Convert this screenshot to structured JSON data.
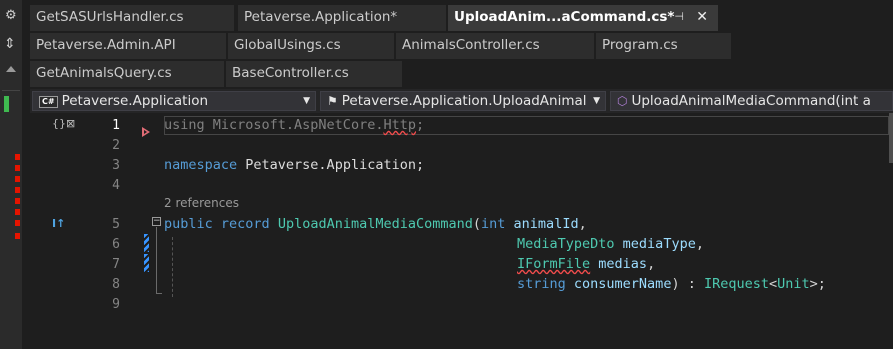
{
  "tabs": {
    "row1": [
      {
        "label": "GetSASUrlsHandler.cs",
        "active": false
      },
      {
        "label": "Petaverse.Application*",
        "active": false
      },
      {
        "label": "UploadAnim...aCommand.cs*",
        "active": true
      }
    ],
    "row2": [
      {
        "label": "Petaverse.Admin.API"
      },
      {
        "label": "GlobalUsings.cs"
      },
      {
        "label": "AnimalsController.cs"
      },
      {
        "label": "Program.cs"
      }
    ],
    "row3": [
      {
        "label": "GetAnimalsQuery.cs"
      },
      {
        "label": "BaseController.cs"
      }
    ],
    "pin_glyph": "⊣",
    "close_glyph": "✕"
  },
  "navbar": {
    "project": "Petaverse.Application",
    "cs_badge": "C#",
    "type": "Petaverse.Application.UploadAnimal",
    "member": "UploadAnimalMediaCommand(int a",
    "dropdown_glyph": "▼"
  },
  "editor": {
    "line_numbers": [
      "1",
      "2",
      "3",
      "4",
      "5",
      "6",
      "7",
      "8",
      "9"
    ],
    "references": "2 references",
    "collapse_glyph": "−",
    "lines": {
      "l1_kw": "using",
      "l1_rest": " Microsoft.AspNetCore.",
      "l1_err": "Http",
      "l1_end": ";",
      "l3_kw": "namespace",
      "l3_rest": " Petaverse.Application;",
      "l5_kw1": "public",
      "l5_kw2": " record",
      "l5_type": " UploadAnimalMediaCommand",
      "l5_open": "(",
      "l5_kw3": "int",
      "l5_par": " animalId",
      "l5_end": ",",
      "l6_type": "MediaTypeDto",
      "l6_par": " mediaType",
      "l6_end": ",",
      "l7_type": "IFormFile",
      "l7_par": " medias",
      "l7_end": ",",
      "l8_kw": "string",
      "l8_par": " consumerName",
      "l8_mid": ") : ",
      "l8_type": "IRequest",
      "l8_lt": "<",
      "l8_unit": "Unit",
      "l8_end": ">;"
    }
  },
  "colors": {
    "keyword": "#569cd6",
    "type": "#4ec9b0",
    "parameter": "#9cdcfe",
    "error_squiggle": "#f14c4c",
    "active_tab": "#3a3a3a"
  }
}
